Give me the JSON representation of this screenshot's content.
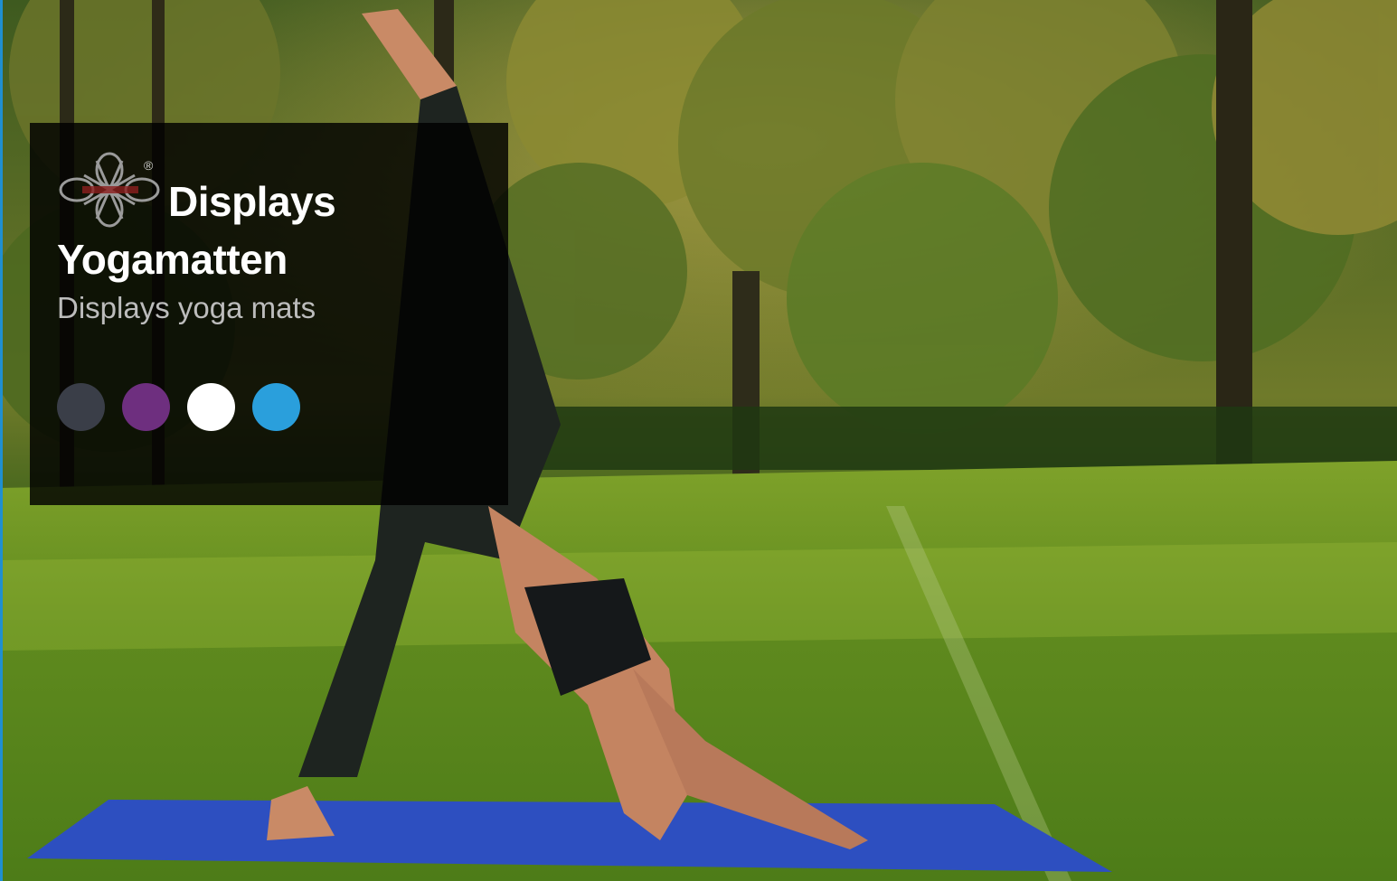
{
  "panel": {
    "title_line1": "Displays",
    "title_line2": "Yogamatten",
    "subtitle": "Displays yoga mats"
  },
  "logo": {
    "icon": "knot-logo-icon",
    "registered_mark": "®"
  },
  "swatches": [
    {
      "name": "dark-gray",
      "color": "#3a3e48"
    },
    {
      "name": "purple",
      "color": "#6e2f7f"
    },
    {
      "name": "white",
      "color": "#ffffff"
    },
    {
      "name": "blue",
      "color": "#2a9fdc"
    }
  ],
  "colors": {
    "accent_edge": "#1f8fd0",
    "mat": "#2d4fc0"
  }
}
